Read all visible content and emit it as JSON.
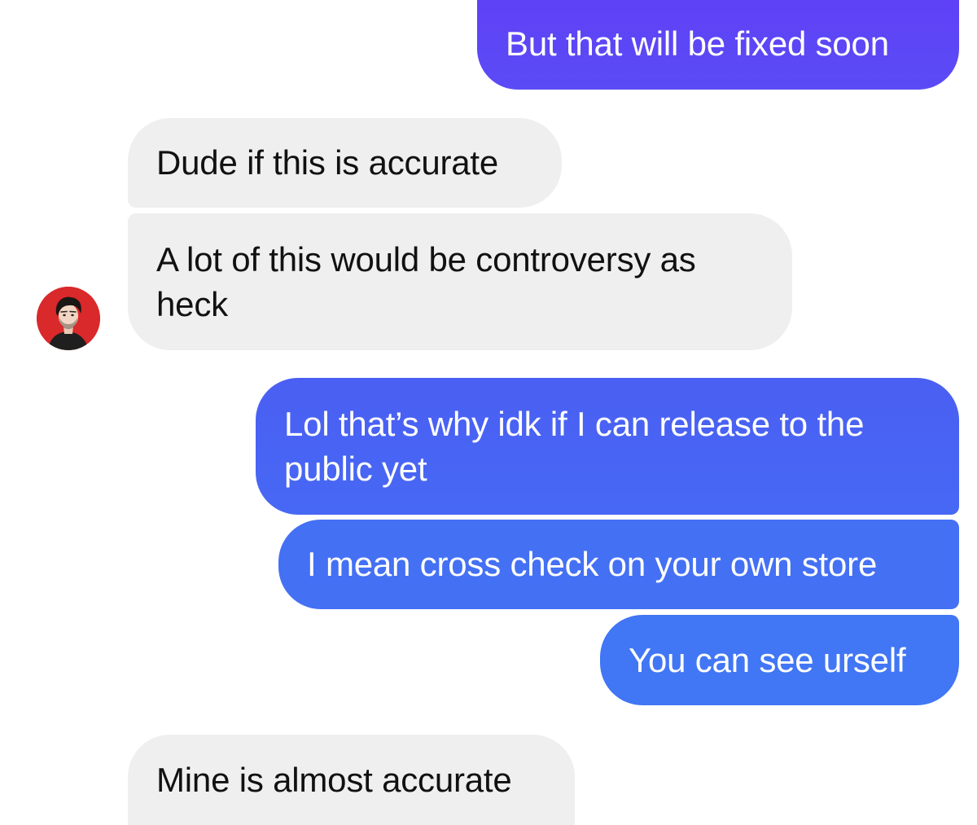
{
  "conversation": {
    "messages": [
      {
        "sender": "me",
        "text": "But that will be fixed soon"
      },
      {
        "sender": "them",
        "text": "Dude if this is accurate"
      },
      {
        "sender": "them",
        "text": "A lot of this would be controversy as heck"
      },
      {
        "sender": "me",
        "text": "Lol that’s why idk if I can release to the public yet"
      },
      {
        "sender": "me",
        "text": "I mean cross check on your own store"
      },
      {
        "sender": "me",
        "text": "You can see urself"
      },
      {
        "sender": "them",
        "text": "Mine is almost accurate"
      }
    ],
    "avatar": {
      "icon": "person-portrait-icon",
      "background_color": "#d9292b"
    }
  },
  "colors": {
    "outgoing_top": "#5f42f6",
    "outgoing_bottom": "#4176f5",
    "incoming_bubble": "#efefef",
    "incoming_text": "#111111",
    "outgoing_text": "#ffffff"
  }
}
